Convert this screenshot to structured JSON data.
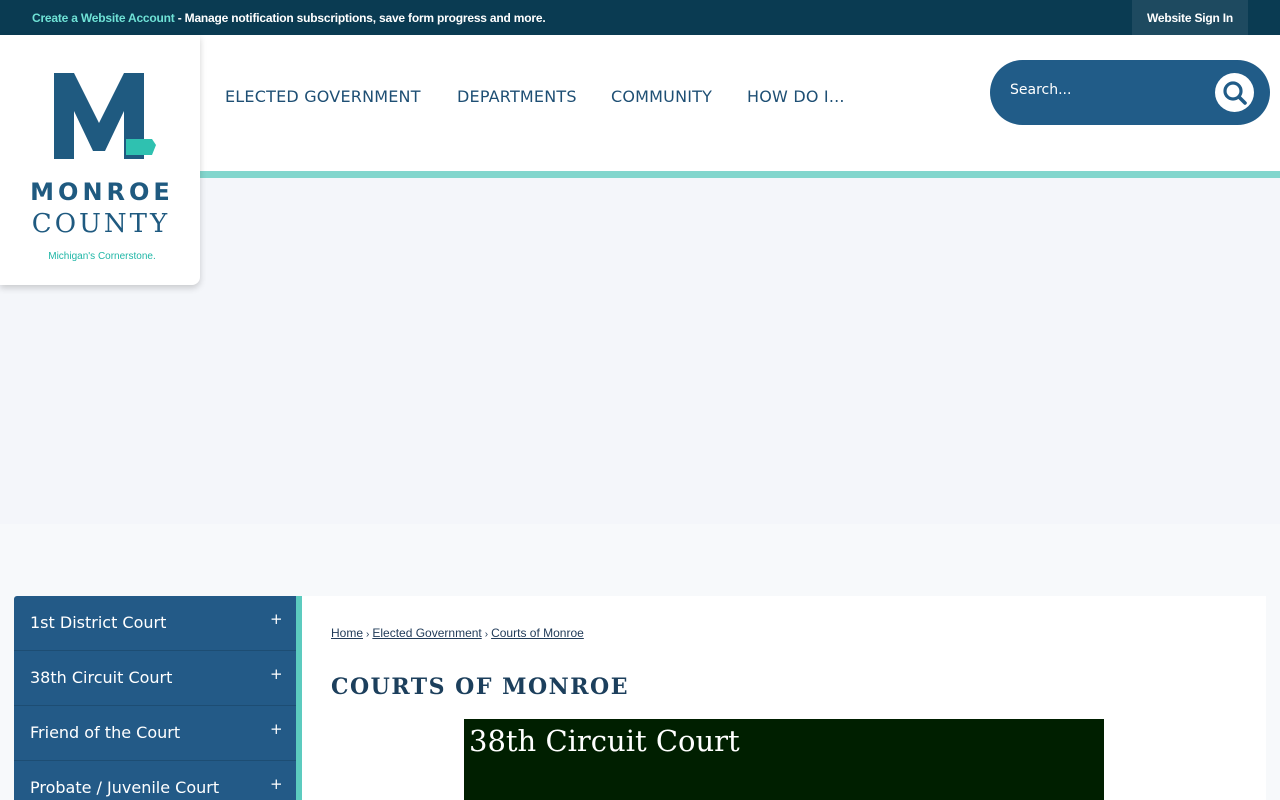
{
  "topbar": {
    "create_account_link": "Create a Website Account",
    "message": " - Manage notification subscriptions, save form progress and more.",
    "sign_in": "Website Sign In"
  },
  "logo": {
    "line1": "MONROE",
    "line2": "COUNTY",
    "tagline": "Michigan's Cornerstone.",
    "colors": {
      "blue": "#1f5a80",
      "teal": "#2fc1b0"
    }
  },
  "nav": {
    "items": [
      "ELECTED GOVERNMENT",
      "DEPARTMENTS",
      "COMMUNITY",
      "HOW DO I..."
    ]
  },
  "search": {
    "placeholder": "Search...",
    "icon": "search-icon"
  },
  "sidebar": {
    "items": [
      {
        "label": "1st District Court",
        "toggle": "+"
      },
      {
        "label": "38th Circuit Court",
        "toggle": "+"
      },
      {
        "label": "Friend of the Court",
        "toggle": "+"
      },
      {
        "label": "Probate / Juvenile Court",
        "toggle": "+"
      }
    ]
  },
  "breadcrumb": {
    "items": [
      "Home",
      "Elected Government",
      "Courts of Monroe"
    ],
    "separator": "›"
  },
  "page": {
    "title": "COURTS OF MONROE",
    "banner_title": "38th Circuit Court"
  },
  "colors": {
    "topbar": "#0a3b52",
    "accent_teal": "#5ccbbf",
    "nav_blue": "#1e4f74",
    "sidebar_blue": "#235a87",
    "banner_bg": "#001f00"
  }
}
